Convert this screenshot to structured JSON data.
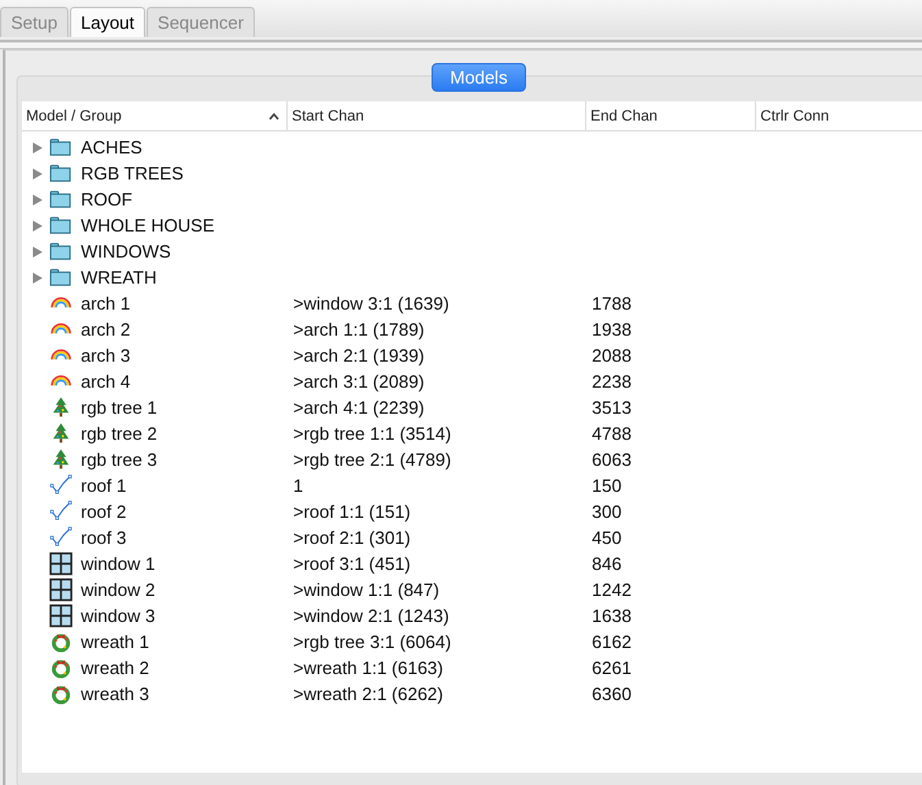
{
  "tabs": [
    {
      "label": "Setup",
      "selected": false
    },
    {
      "label": "Layout",
      "selected": true
    },
    {
      "label": "Sequencer",
      "selected": false
    }
  ],
  "panel_button": "Models",
  "table": {
    "columns": [
      {
        "label": "Model / Group",
        "sorted": true
      },
      {
        "label": "Start Chan"
      },
      {
        "label": "End Chan"
      },
      {
        "label": "Ctrlr Conn"
      }
    ],
    "rows": [
      {
        "kind": "group",
        "name": "ACHES",
        "expanded": false
      },
      {
        "kind": "group",
        "name": "RGB TREES",
        "expanded": false
      },
      {
        "kind": "group",
        "name": "ROOF",
        "expanded": false
      },
      {
        "kind": "group",
        "name": "WHOLE HOUSE",
        "expanded": false
      },
      {
        "kind": "group",
        "name": "WINDOWS",
        "expanded": false
      },
      {
        "kind": "group",
        "name": "WREATH",
        "expanded": false
      },
      {
        "kind": "arch",
        "name": "arch 1",
        "start": ">window 3:1 (1639)",
        "end": "1788"
      },
      {
        "kind": "arch",
        "name": "arch 2",
        "start": ">arch 1:1 (1789)",
        "end": "1938"
      },
      {
        "kind": "arch",
        "name": "arch 3",
        "start": ">arch 2:1 (1939)",
        "end": "2088"
      },
      {
        "kind": "arch",
        "name": "arch 4",
        "start": ">arch 3:1 (2089)",
        "end": "2238"
      },
      {
        "kind": "tree",
        "name": "rgb tree 1",
        "start": ">arch 4:1 (2239)",
        "end": "3513"
      },
      {
        "kind": "tree",
        "name": "rgb tree 2",
        "start": ">rgb tree 1:1 (3514)",
        "end": "4788"
      },
      {
        "kind": "tree",
        "name": "rgb tree 3",
        "start": ">rgb tree 2:1 (4789)",
        "end": "6063"
      },
      {
        "kind": "line",
        "name": "roof 1",
        "start": "1",
        "end": "150"
      },
      {
        "kind": "line",
        "name": "roof 2",
        "start": ">roof 1:1 (151)",
        "end": "300"
      },
      {
        "kind": "line",
        "name": "roof 3",
        "start": ">roof 2:1 (301)",
        "end": "450"
      },
      {
        "kind": "window",
        "name": "window 1",
        "start": ">roof 3:1 (451)",
        "end": "846"
      },
      {
        "kind": "window",
        "name": "window 2",
        "start": ">window 1:1 (847)",
        "end": "1242"
      },
      {
        "kind": "window",
        "name": "window 3",
        "start": ">window 2:1 (1243)",
        "end": "1638"
      },
      {
        "kind": "wreath",
        "name": "wreath 1",
        "start": ">rgb tree 3:1 (6064)",
        "end": "6162"
      },
      {
        "kind": "wreath",
        "name": "wreath 2",
        "start": ">wreath 1:1 (6163)",
        "end": "6261"
      },
      {
        "kind": "wreath",
        "name": "wreath 3",
        "start": ">wreath 2:1 (6262)",
        "end": "6360"
      }
    ]
  }
}
